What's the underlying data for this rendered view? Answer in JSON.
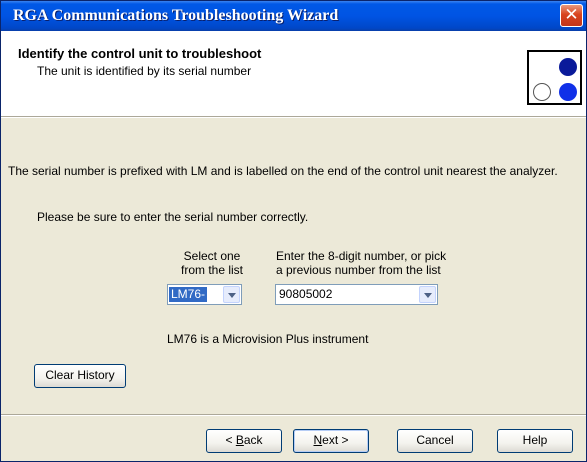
{
  "window": {
    "title": "RGA Communications Troubleshooting Wizard",
    "close_glyph": "✕"
  },
  "header": {
    "title": "Identify the control unit to troubleshoot",
    "subtitle": "The unit is identified by its serial number",
    "logo_icon": "three-dots-logo-icon"
  },
  "body": {
    "instruction": "The serial number is prefixed with LM and is labelled on the end of the control unit nearest the analyzer.",
    "note": "Please be sure to enter the serial number correctly.",
    "prefix_label_line1": "Select one",
    "prefix_label_line2": "from the list",
    "prefix_value": "LM76-",
    "number_label_line1": "Enter the 8-digit number, or pick",
    "number_label_line2": "a previous number from the list",
    "number_value": "90805002",
    "instrument_info": "LM76 is a Microvision Plus instrument",
    "clear_history_label": "Clear History"
  },
  "footer": {
    "back_prefix": "< ",
    "back_key": "B",
    "back_rest": "ack",
    "next_key": "N",
    "next_rest": "ext >",
    "cancel_label": "Cancel",
    "help_label": "Help"
  },
  "colors": {
    "titlebar": "#0054e3",
    "dialog_bg": "#ece9d8",
    "header_bg": "#ffffff",
    "selection": "#316ac5"
  }
}
